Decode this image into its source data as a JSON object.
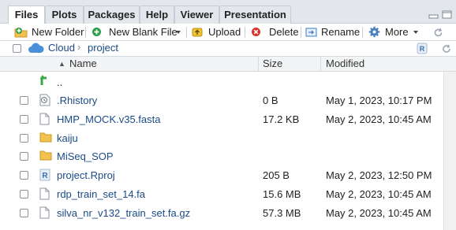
{
  "tabs": [
    {
      "label": "Files",
      "active": true
    },
    {
      "label": "Plots"
    },
    {
      "label": "Packages"
    },
    {
      "label": "Help"
    },
    {
      "label": "Viewer"
    },
    {
      "label": "Presentation"
    }
  ],
  "toolbar": {
    "new_folder": "New Folder",
    "new_blank_file": "New Blank File",
    "upload": "Upload",
    "delete": "Delete",
    "rename": "Rename",
    "more": "More"
  },
  "breadcrumb": {
    "root": "Cloud",
    "separator": "›",
    "current": "project"
  },
  "columns": {
    "name": "Name",
    "size": "Size",
    "modified": "Modified",
    "sort_indicator": "▲"
  },
  "parent_label": "..",
  "files": [
    {
      "name": ".Rhistory",
      "size": "0 B",
      "modified": "May 1, 2023, 10:17 PM",
      "icon": "history-file-icon"
    },
    {
      "name": "HMP_MOCK.v35.fasta",
      "size": "17.2 KB",
      "modified": "May 2, 2023, 10:45 AM",
      "icon": "file-icon"
    },
    {
      "name": "kaiju",
      "size": "",
      "modified": "",
      "icon": "folder-icon"
    },
    {
      "name": "MiSeq_SOP",
      "size": "",
      "modified": "",
      "icon": "folder-icon"
    },
    {
      "name": "project.Rproj",
      "size": "205 B",
      "modified": "May 2, 2023, 12:50 PM",
      "icon": "rproj-icon"
    },
    {
      "name": "rdp_train_set_14.fa",
      "size": "15.6 MB",
      "modified": "May 2, 2023, 10:45 AM",
      "icon": "file-icon"
    },
    {
      "name": "silva_nr_v132_train_set.fa.gz",
      "size": "57.3 MB",
      "modified": "May 2, 2023, 10:45 AM",
      "icon": "file-icon"
    }
  ],
  "colors": {
    "link": "#1b4a86",
    "folder": "#f2c14e",
    "parent_arrow": "#3aa845",
    "cloud": "#4a90d9",
    "new_button": "#2e9d48",
    "delete_button": "#d9342b"
  }
}
